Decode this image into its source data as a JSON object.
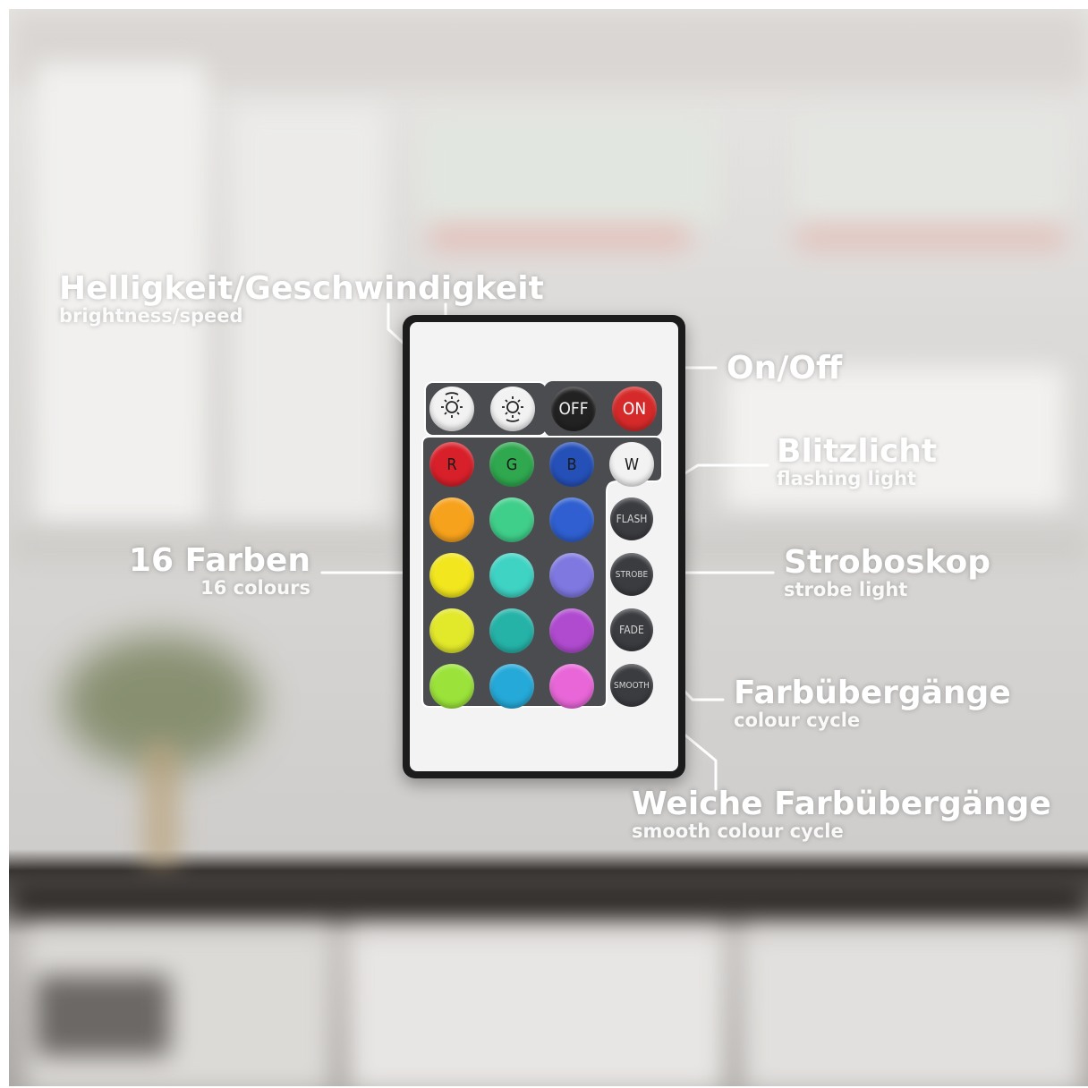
{
  "annotations": {
    "brightness": {
      "main": "Helligkeit/Geschwindigkeit",
      "sub": "brightness/speed"
    },
    "onoff": {
      "main": "On/Off"
    },
    "flash": {
      "main": "Blitzlicht",
      "sub": "flashing light"
    },
    "colors16": {
      "main": "16 Farben",
      "sub": "16 colours"
    },
    "strobe": {
      "main": "Stroboskop",
      "sub": "strobe light"
    },
    "fade": {
      "main": "Farbübergänge",
      "sub": "colour cycle"
    },
    "smooth": {
      "main": "Weiche Farbübergänge",
      "sub": "smooth colour cycle"
    }
  },
  "remote": {
    "top_buttons": {
      "brightness_down_icon": "sun-down-icon",
      "brightness_up_icon": "sun-up-icon",
      "off_label": "OFF",
      "on_label": "ON"
    },
    "color_rows": [
      [
        {
          "label": "R",
          "color": "#d8202a"
        },
        {
          "label": "G",
          "color": "#2fa84f"
        },
        {
          "label": "B",
          "color": "#2550b8"
        },
        {
          "label": "W",
          "color": "#f2f2f2"
        }
      ],
      [
        {
          "label": "",
          "color": "#f7a21c"
        },
        {
          "label": "",
          "color": "#3fcf8a"
        },
        {
          "label": "",
          "color": "#2f5fd0"
        }
      ],
      [
        {
          "label": "",
          "color": "#f2e61e"
        },
        {
          "label": "",
          "color": "#3fd3c4"
        },
        {
          "label": "",
          "color": "#7f78e0"
        }
      ],
      [
        {
          "label": "",
          "color": "#e2e82a"
        },
        {
          "label": "",
          "color": "#25b3a8"
        },
        {
          "label": "",
          "color": "#b04bd0"
        }
      ],
      [
        {
          "label": "",
          "color": "#9be33a"
        },
        {
          "label": "",
          "color": "#25a9d8"
        },
        {
          "label": "",
          "color": "#e866d8"
        }
      ]
    ],
    "mode_buttons": [
      "FLASH",
      "STROBE",
      "FADE",
      "SMOOTH"
    ]
  },
  "colors": {
    "label_text": "#ffffff",
    "remote_body": "#1c1c1c",
    "panel": "#4a4c50"
  }
}
